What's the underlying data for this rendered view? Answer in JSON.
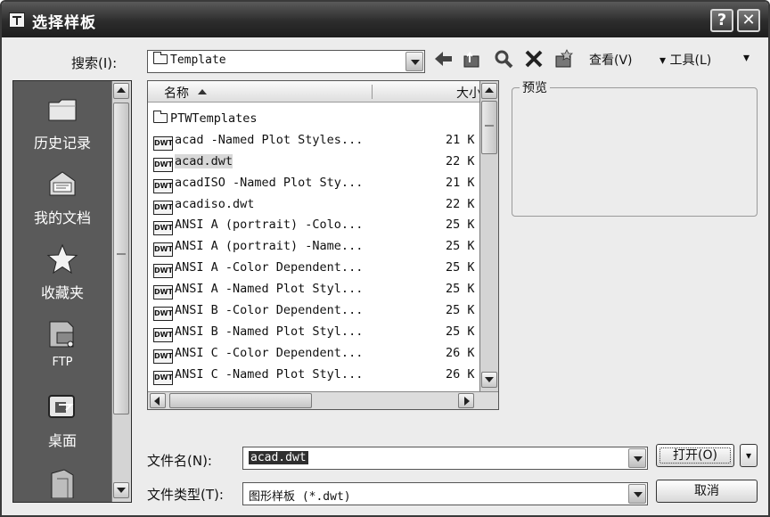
{
  "window": {
    "title": "选择样板",
    "help_label": "?",
    "close_label": "✕"
  },
  "search": {
    "label": "搜索(I):",
    "value": "Template"
  },
  "toolbar": {
    "view_label": "查看(V)",
    "tools_label": "▾ 工具(L)",
    "more_label": "▾"
  },
  "places": [
    {
      "label": "历史记录",
      "icon": "history-folder-icon"
    },
    {
      "label": "我的文档",
      "icon": "documents-folder-icon"
    },
    {
      "label": "收藏夹",
      "icon": "favorites-star-icon"
    },
    {
      "label": "FTP",
      "icon": "ftp-icon"
    },
    {
      "label": "桌面",
      "icon": "desktop-icon"
    }
  ],
  "filelist": {
    "col_name": "名称",
    "col_size": "大小",
    "rows": [
      {
        "name": "PTWTemplates",
        "size": "",
        "type": "folder"
      },
      {
        "name": "acad -Named Plot Styles...",
        "size": "21 K",
        "type": "dwt"
      },
      {
        "name": "acad.dwt",
        "size": "22 K",
        "type": "dwt",
        "selected": true
      },
      {
        "name": "acadISO -Named Plot Sty...",
        "size": "21 K",
        "type": "dwt"
      },
      {
        "name": "acadiso.dwt",
        "size": "22 K",
        "type": "dwt"
      },
      {
        "name": "ANSI A (portrait) -Colo...",
        "size": "25 K",
        "type": "dwt"
      },
      {
        "name": "ANSI A (portrait) -Name...",
        "size": "25 K",
        "type": "dwt"
      },
      {
        "name": "ANSI A -Color Dependent...",
        "size": "25 K",
        "type": "dwt"
      },
      {
        "name": "ANSI A -Named Plot Styl...",
        "size": "25 K",
        "type": "dwt"
      },
      {
        "name": "ANSI B -Color Dependent...",
        "size": "25 K",
        "type": "dwt"
      },
      {
        "name": "ANSI B -Named Plot Styl...",
        "size": "25 K",
        "type": "dwt"
      },
      {
        "name": "ANSI C -Color Dependent...",
        "size": "26 K",
        "type": "dwt"
      },
      {
        "name": "ANSI C -Named Plot Styl...",
        "size": "26 K",
        "type": "dwt"
      }
    ]
  },
  "preview": {
    "label": "预览"
  },
  "filename": {
    "label": "文件名(N):",
    "value": "acad.dwt"
  },
  "filetype": {
    "label": "文件类型(T):",
    "value": "图形样板 (*.dwt)"
  },
  "buttons": {
    "open_label": "打开(O)",
    "cancel_label": "取消",
    "open_menu_label": "▾"
  },
  "colors": {
    "titlebar": "#2c2c2c",
    "dialog_bg": "#ececec",
    "places_bg": "#5a5a5a",
    "selection": "#2f2f2f"
  }
}
